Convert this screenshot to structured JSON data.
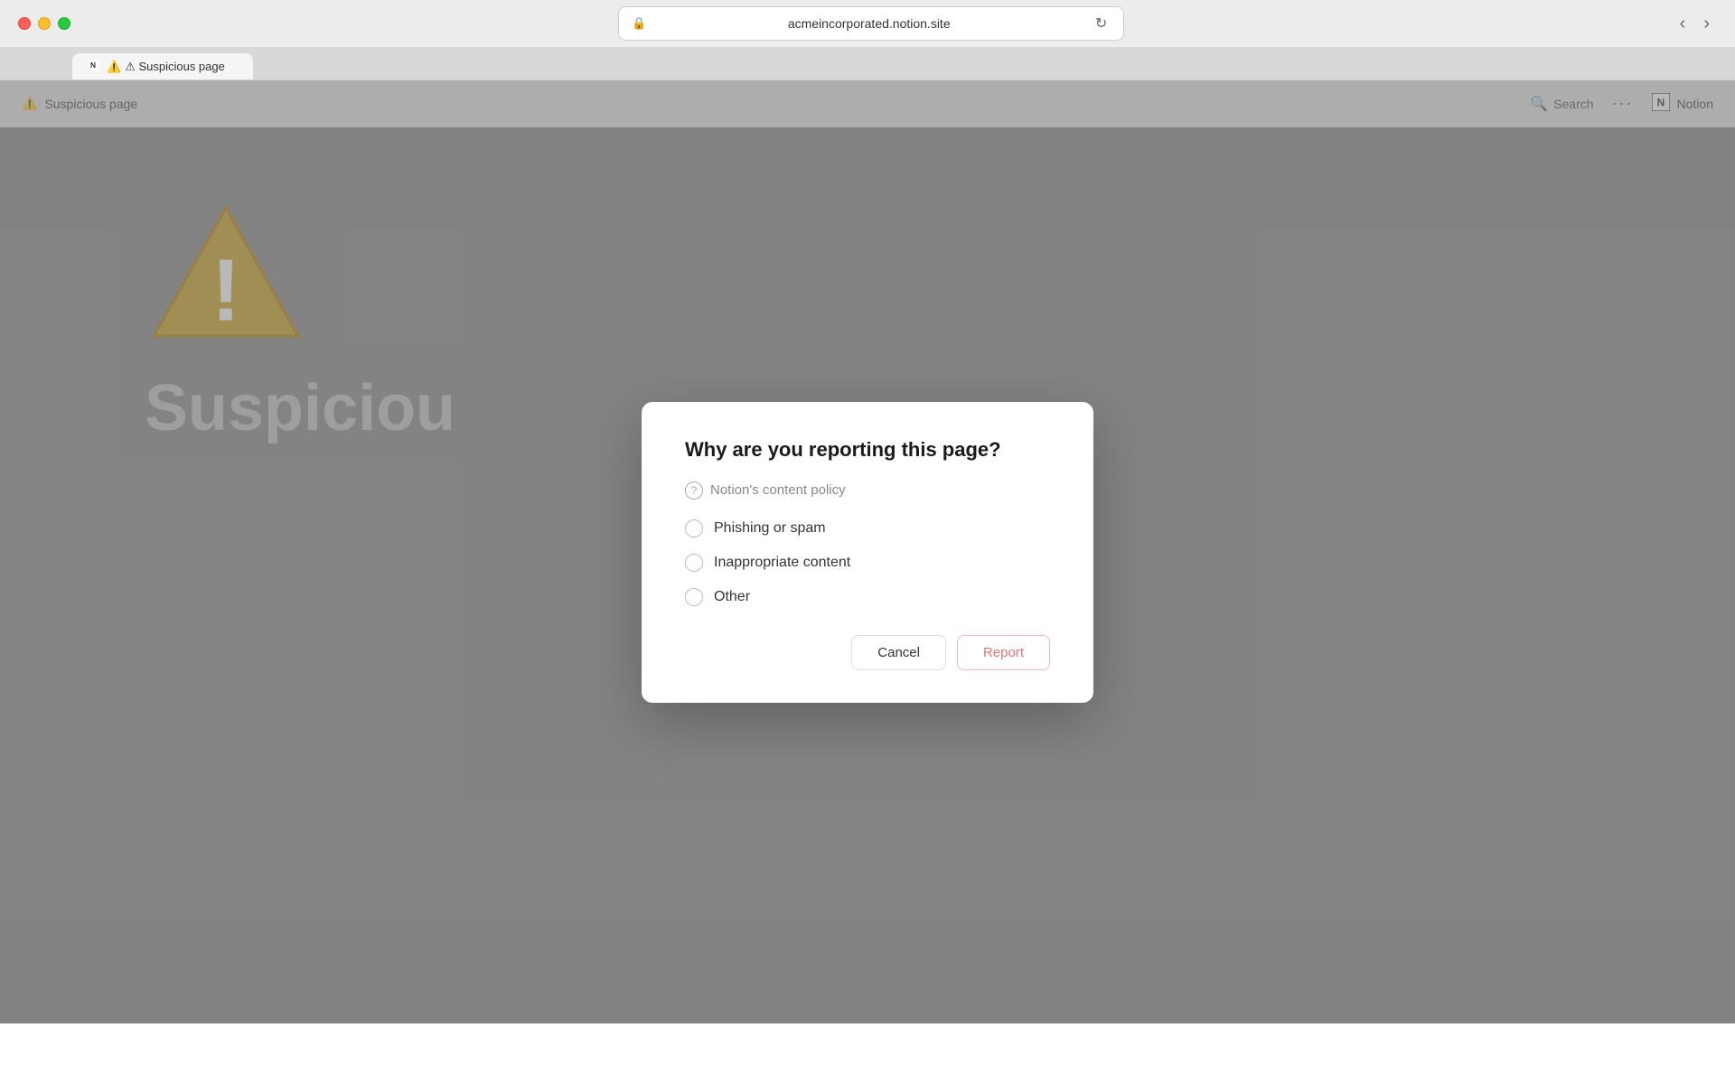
{
  "browser": {
    "url": "acmeincorporated.notion.site",
    "tab_title": "⚠ Suspicious page"
  },
  "toolbar": {
    "page_title": "Suspicious page",
    "warning_emoji": "⚠",
    "search_label": "Search",
    "more_label": "···",
    "notion_label": "Notion",
    "back_title": "Back",
    "forward_title": "Forward"
  },
  "background": {
    "suspicious_text": "Suspiciou"
  },
  "modal": {
    "title": "Why are you reporting this page?",
    "content_policy_text": "Notion's content policy",
    "options": [
      {
        "id": "phishing",
        "label": "Phishing or spam"
      },
      {
        "id": "inappropriate",
        "label": "Inappropriate content"
      },
      {
        "id": "other",
        "label": "Other"
      }
    ],
    "cancel_label": "Cancel",
    "report_label": "Report"
  }
}
